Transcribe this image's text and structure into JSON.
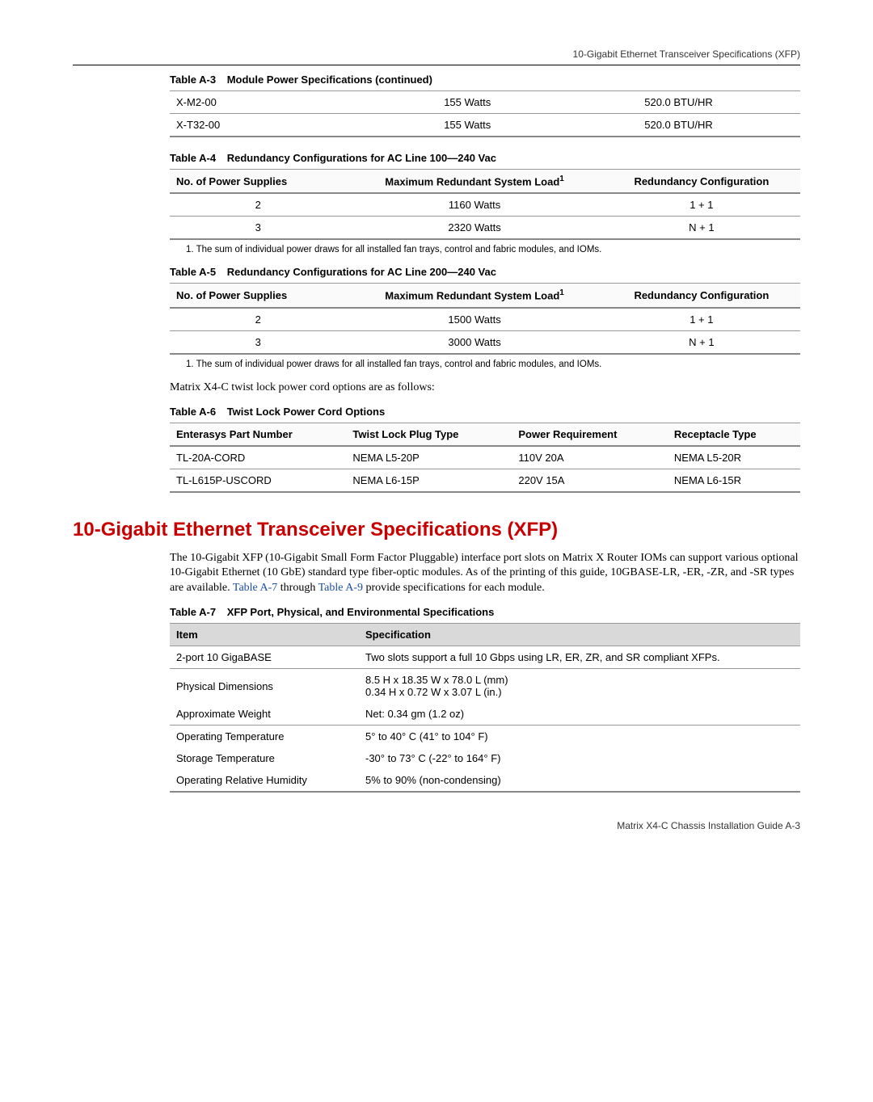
{
  "topHeader": "10-Gigabit Ethernet Transceiver Specifications (XFP)",
  "tableA3": {
    "caption_num": "Table A-3",
    "caption_txt": "Module Power Specifications (continued)",
    "rows": [
      {
        "c0": "X-M2-00",
        "c1": "155 Watts",
        "c2": "520.0 BTU/HR"
      },
      {
        "c0": "X-T32-00",
        "c1": "155 Watts",
        "c2": "520.0 BTU/HR"
      }
    ]
  },
  "tableA4": {
    "caption_num": "Table A-4",
    "caption_txt": "Redundancy Configurations for AC Line 100—240 Vac",
    "h0": "No. of Power Supplies",
    "h1": "Maximum Redundant System Load",
    "h1_sup": "1",
    "h2": "Redundancy Configuration",
    "rows": [
      {
        "c0": "2",
        "c1": "1160 Watts",
        "c2": "1 + 1"
      },
      {
        "c0": "3",
        "c1": "2320 Watts",
        "c2": "N + 1"
      }
    ],
    "footnote": "1. The sum of individual power draws for all installed fan trays, control and fabric modules, and IOMs."
  },
  "tableA5": {
    "caption_num": "Table A-5",
    "caption_txt": "Redundancy Configurations for AC Line 200—240 Vac",
    "h0": "No. of Power Supplies",
    "h1": "Maximum Redundant System Load",
    "h1_sup": "1",
    "h2": "Redundancy Configuration",
    "rows": [
      {
        "c0": "2",
        "c1": "1500 Watts",
        "c2": "1 + 1"
      },
      {
        "c0": "3",
        "c1": "3000 Watts",
        "c2": "N + 1"
      }
    ],
    "footnote": "1. The sum of individual power draws for all installed fan trays, control and fabric modules, and IOMs."
  },
  "bodyText1": "Matrix X4-C twist lock power cord options are as follows:",
  "tableA6": {
    "caption_num": "Table A-6",
    "caption_txt": "Twist Lock Power Cord Options",
    "h0": "Enterasys Part Number",
    "h1": "Twist Lock Plug Type",
    "h2": "Power Requirement",
    "h3": "Receptacle Type",
    "rows": [
      {
        "c0": "TL-20A-CORD",
        "c1": "NEMA L5-20P",
        "c2": "110V 20A",
        "c3": "NEMA L5-20R"
      },
      {
        "c0": "TL-L615P-USCORD",
        "c1": "NEMA L6-15P",
        "c2": "220V 15A",
        "c3": "NEMA L6-15R"
      }
    ]
  },
  "sectionHeading": "10-Gigabit Ethernet Transceiver Specifications (XFP)",
  "bodyText2_a": "The 10-Gigabit XFP (10-Gigabit Small Form Factor Pluggable) interface port slots on Matrix X Router IOMs can support various optional 10-Gigabit Ethernet (10 GbE) standard type fiber-optic modules. As of the printing of this guide, 10GBASE-LR, -ER, -ZR, and -SR types are available. ",
  "bodyText2_link1": "Table A-7",
  "bodyText2_mid": " through ",
  "bodyText2_link2": "Table A-9",
  "bodyText2_b": " provide specifications for each module.",
  "tableA7": {
    "caption_num": "Table A-7",
    "caption_txt": "XFP Port, Physical, and Environmental Specifications",
    "h0": "Item",
    "h1": "Specification",
    "rows": [
      {
        "c0": "2-port 10 GigaBASE",
        "c1": "Two slots support a full 10 Gbps using LR, ER, ZR, and SR compliant XFPs."
      },
      {
        "c0": "Physical Dimensions",
        "c1a": "8.5 H x 18.35 W x 78.0 L (mm)",
        "c1b": "0.34 H x 0.72 W x 3.07 L (in.)"
      },
      {
        "c0": "Approximate Weight",
        "c1": "Net: 0.34 gm (1.2 oz)"
      },
      {
        "c0": "Operating Temperature",
        "c1": "5° to 40° C (41° to 104° F)"
      },
      {
        "c0": "Storage Temperature",
        "c1": "-30° to 73° C (-22° to 164° F)"
      },
      {
        "c0": "Operating Relative Humidity",
        "c1": "5% to 90% (non-condensing)"
      }
    ]
  },
  "footer": "Matrix X4-C Chassis Installation Guide   A-3"
}
